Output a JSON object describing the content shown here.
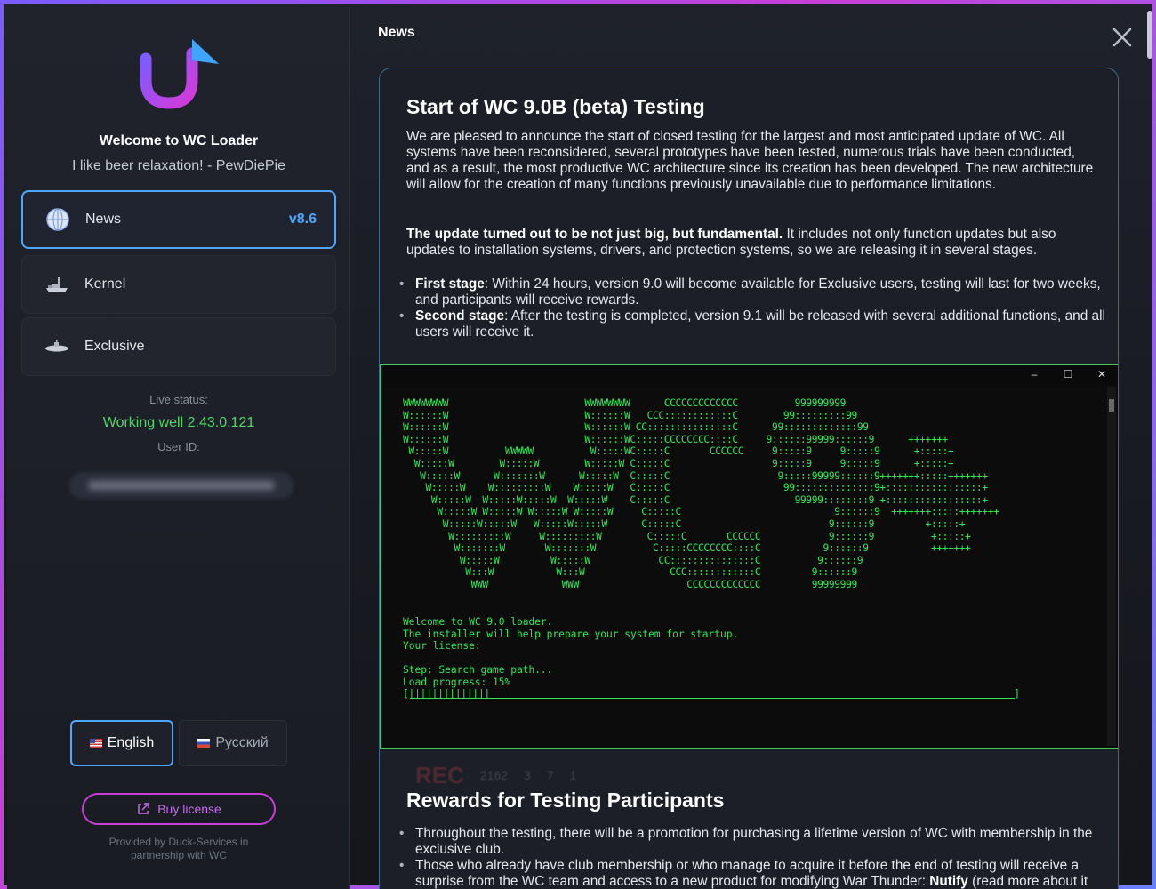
{
  "sidebar": {
    "welcome": "Welcome to WC Loader",
    "tagline": "I like beer relaxation! - PewDiePie",
    "nav": [
      {
        "label": "News",
        "badge": "v8.6",
        "icon": "globe-icon",
        "active": true
      },
      {
        "label": "Kernel",
        "icon": "ship-icon",
        "active": false
      },
      {
        "label": "Exclusive",
        "icon": "submarine-icon",
        "active": false
      }
    ],
    "live_status_label": "Live status:",
    "live_status_value": "Working well 2.43.0.121",
    "user_id_label": "User ID:",
    "languages": [
      {
        "label": "English",
        "flag": "us",
        "active": true
      },
      {
        "label": "Русский",
        "flag": "ru",
        "active": false
      }
    ],
    "buy_label": "Buy license",
    "provided_line1": "Provided by Duck-Services in",
    "provided_line2": "partnership with WC",
    "accent": "#4ea6ff",
    "brand_gradient": [
      "#7a5cff",
      "#c83fd8"
    ]
  },
  "main": {
    "title": "News",
    "article": {
      "heading": "Start of WC 9.0B (beta) Testing",
      "intro": "We are pleased to announce the start of closed testing for the largest and most anticipated update of WC. All systems have been reconsidered, several prototypes have been tested, numerous trials have been conducted, and as a result, the most productive WC architecture since its creation has been developed. The new architecture will allow for the creation of many functions previously unavailable due to performance limitations.",
      "fundamental_bold": "The update turned out to be not just big, but fundamental.",
      "fundamental_rest": " It includes not only function updates but also updates to installation systems, drivers, and protection systems, so we are releasing it in several stages.",
      "stages": [
        {
          "name": "First stage",
          "text": ": Within 24 hours, version 9.0 will become available for Exclusive users, testing will last for two weeks, and participants will receive rewards."
        },
        {
          "name": "Second stage",
          "text": ": After the testing is completed, version 9.1 will be released with several additional functions, and all users will receive it."
        }
      ],
      "terminal": {
        "controls": [
          "–",
          "☐",
          "✕"
        ],
        "line1": "Welcome to WC 9.0 loader.",
        "line2": "The installer will help prepare your system for startup.",
        "line3": "Your license:",
        "line4": "Step: Search game path...",
        "line5": "Load progress: 15%",
        "progress_percent": 15,
        "progress_bars": "[||||||||||||||",
        "progress_end": "]",
        "color": "#2ee85a"
      },
      "rewards_heading": "Rewards for Testing Participants",
      "rewards": [
        {
          "text": "Throughout the testing, there will be a promotion for purchasing a lifetime version of WC with membership in the exclusive club."
        },
        {
          "text": "Those who already have club membership or who manage to acquire it before the end of testing will receive a surprise from the WC team and access to a new product for modifying War Thunder: ",
          "bold": "Nutify",
          "tail": " (read more about it"
        }
      ],
      "bg_deco": {
        "rec": "REC",
        "n1": "2162",
        "n2": "3",
        "n3": "7",
        "n4": "1"
      }
    }
  }
}
